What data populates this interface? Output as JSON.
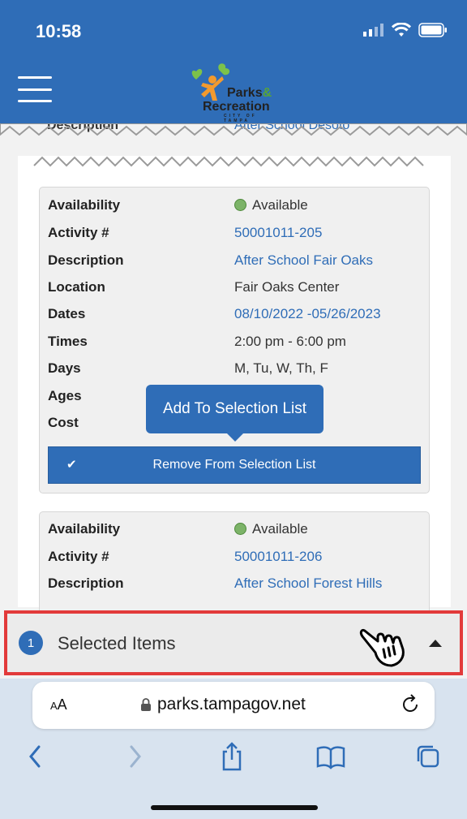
{
  "status_bar": {
    "time": "10:58"
  },
  "logo": {
    "line1": "Parks",
    "amp": "&",
    "line2": "Recreation",
    "line3": "CITY OF TAMPA"
  },
  "torn_row": {
    "label": "Description",
    "value": "After School Desoto"
  },
  "cards": [
    {
      "rows": [
        {
          "label": "Availability",
          "value": "Available",
          "status": "available"
        },
        {
          "label": "Activity #",
          "value": "50001011-205",
          "link": true
        },
        {
          "label": "Description",
          "value": "After School Fair Oaks",
          "link": true
        },
        {
          "label": "Location",
          "value": "Fair Oaks Center"
        },
        {
          "label": "Dates",
          "value": "08/10/2022 -05/26/2023",
          "link": true
        },
        {
          "label": "Times",
          "value": "2:00 pm - 6:00 pm"
        },
        {
          "label": "Days",
          "value": "M, Tu, W, Th, F"
        },
        {
          "label": "Ages",
          "value": ""
        },
        {
          "label": "Cost",
          "value": ""
        }
      ],
      "button_label": "Remove From Selection List"
    },
    {
      "rows": [
        {
          "label": "Availability",
          "value": "Available",
          "status": "available"
        },
        {
          "label": "Activity #",
          "value": "50001011-206",
          "link": true
        },
        {
          "label": "Description",
          "value": "After School Forest Hills",
          "link": true
        }
      ]
    }
  ],
  "tooltip": {
    "label": "Add To Selection List"
  },
  "selected_bar": {
    "count": "1",
    "label": "Selected Items"
  },
  "safari": {
    "text_size": "AA",
    "url": "parks.tampagov.net"
  },
  "colors": {
    "primary": "#2f6db7",
    "available": "#7cb368",
    "highlight": "#e23a3a"
  }
}
